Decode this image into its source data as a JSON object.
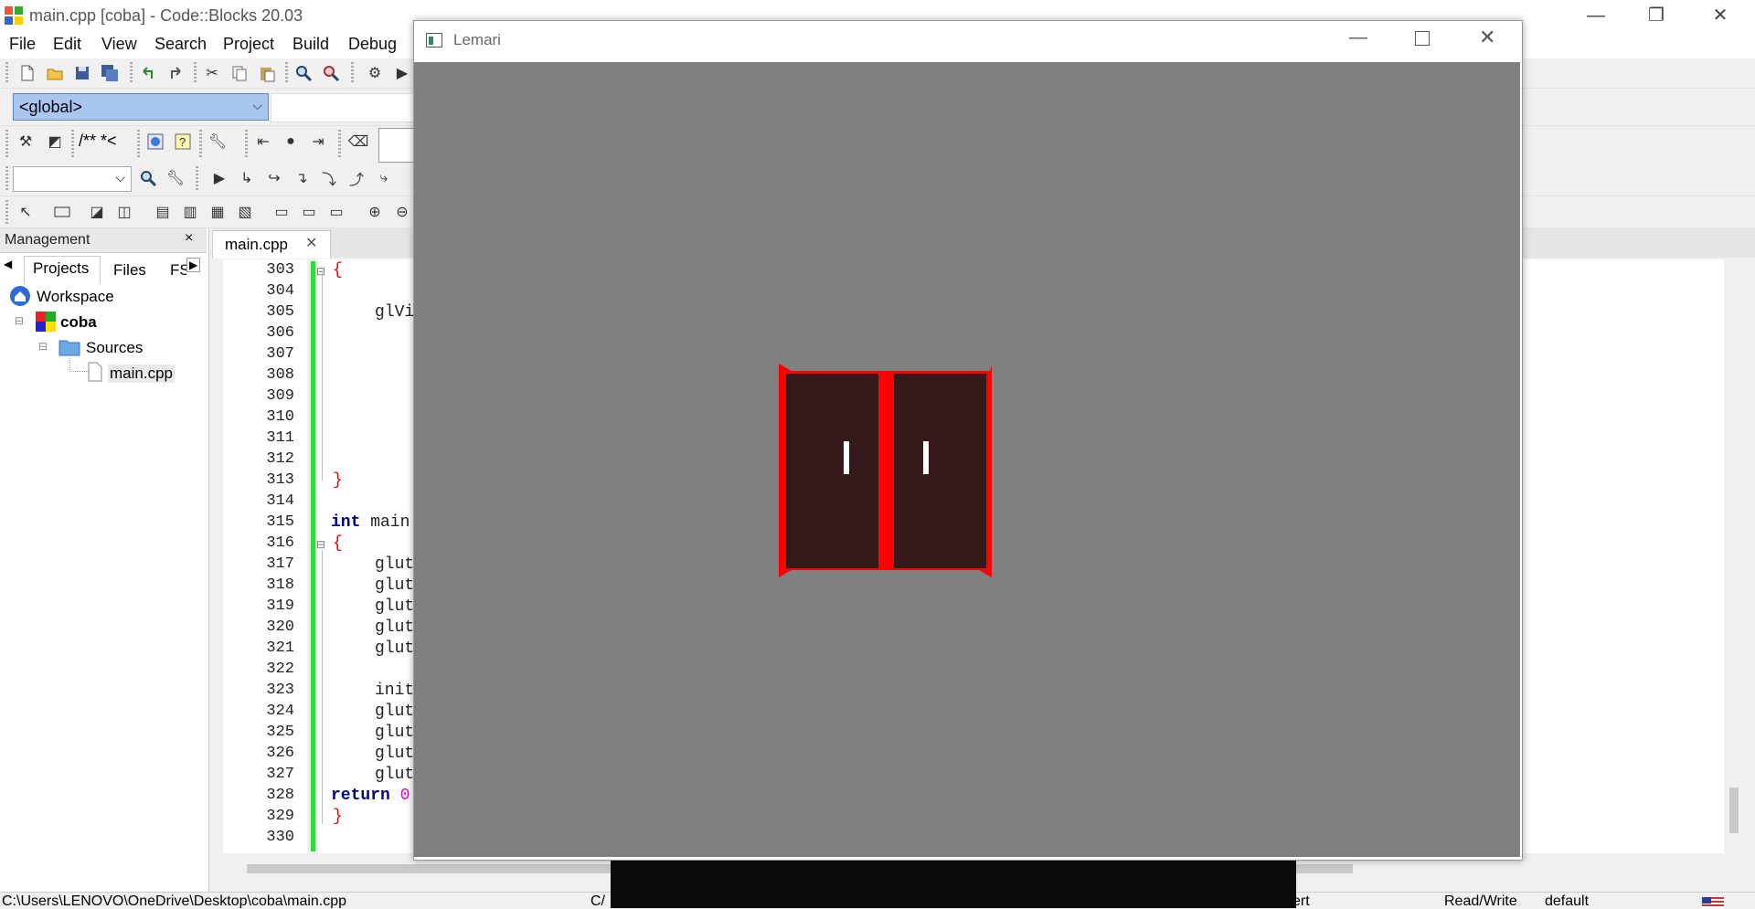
{
  "app": {
    "title": "main.cpp [coba] - Code::Blocks 20.03"
  },
  "window_controls": {
    "minimize": "—",
    "restore": "❐",
    "close": "✕"
  },
  "menu": [
    "File",
    "Edit",
    "View",
    "Search",
    "Project",
    "Build",
    "Debug"
  ],
  "scope_select": {
    "value": "<global>"
  },
  "doxy_toolbar": {
    "comment_label": "/** *<"
  },
  "management": {
    "title": "Management",
    "close": "×",
    "tabs": [
      "Projects",
      "Files",
      "FS"
    ],
    "tree": {
      "workspace": "Workspace",
      "project": "coba",
      "folder": "Sources",
      "file": "main.cpp"
    }
  },
  "editor": {
    "tab_label": "main.cpp",
    "tab_close": "✕",
    "line_numbers": [
      "303",
      "304",
      "305",
      "306",
      "307",
      "308",
      "309",
      "310",
      "311",
      "312",
      "313",
      "314",
      "315",
      "316",
      "317",
      "318",
      "319",
      "320",
      "321",
      "322",
      "323",
      "324",
      "325",
      "326",
      "327",
      "328",
      "329",
      "330"
    ],
    "code": {
      "l303": "{",
      "l305": "glVi",
      "l313": "}",
      "l315_kw": "int",
      "l315_rest": " main",
      "l316": "{",
      "l317": "glut",
      "l318": "glut",
      "l319": "glut",
      "l320": "glut",
      "l321": "glut",
      "l323": "init",
      "l324": "glut",
      "l325": "glut",
      "l326": "glut",
      "l327": "glut",
      "l328_kw": "return",
      "l328_rest": " 0",
      "l329": "}"
    }
  },
  "statusbar": {
    "path": "C:\\Users\\LENOVO\\OneDrive\\Desktop\\coba\\main.cpp",
    "col2": "C/",
    "col3": "ert",
    "rw": "Read/Write",
    "mode": "default"
  },
  "lemari_window": {
    "title": "Lemari",
    "canvas_color": "#808080",
    "frame_color": "#ff0000",
    "door_color": "#36191b",
    "handle_color": "#ffffff"
  }
}
